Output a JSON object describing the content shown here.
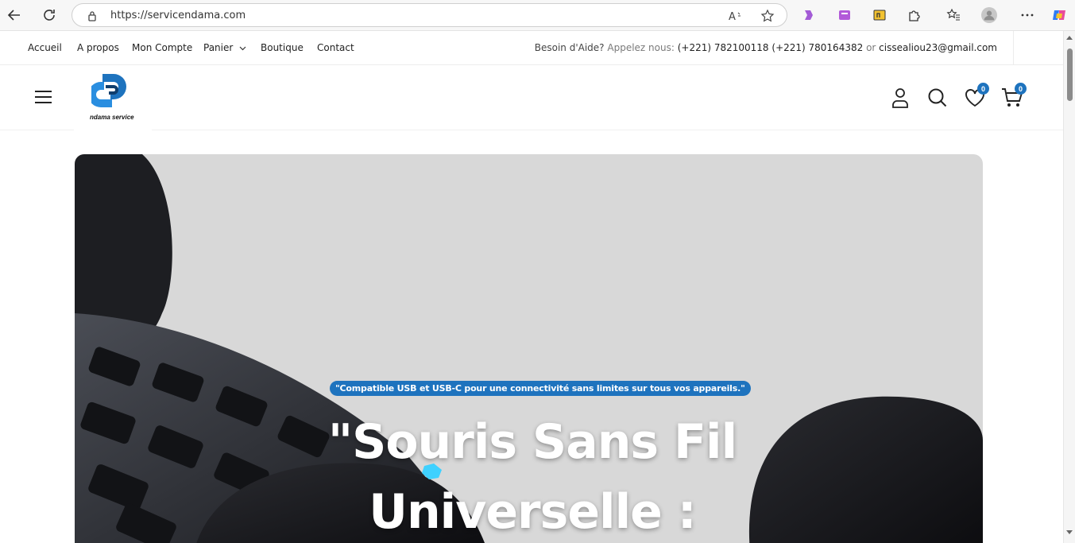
{
  "browser": {
    "url": "https://servicendama.com"
  },
  "topnav": {
    "links": [
      "Accueil",
      "A propos",
      "Mon Compte",
      "Panier",
      "Boutique",
      "Contact"
    ],
    "help_prefix": "Besoin d'Aide?",
    "call_label": "Appelez nous:",
    "phones": "(+221) 782100118 (+221) 780164382",
    "or_label": "or",
    "email": "cissealiou23@gmail.com"
  },
  "header": {
    "logo_text": "ndama service",
    "wishlist_count": "0",
    "cart_count": "0"
  },
  "hero": {
    "tagline": "\"Compatible USB et USB-C pour une connectivité sans limites sur tous vos appareils.\"",
    "title": "\"Souris Sans Fil Universelle :"
  },
  "colors": {
    "accent": "#1e73be",
    "hero_bg": "#d8d8d8"
  }
}
